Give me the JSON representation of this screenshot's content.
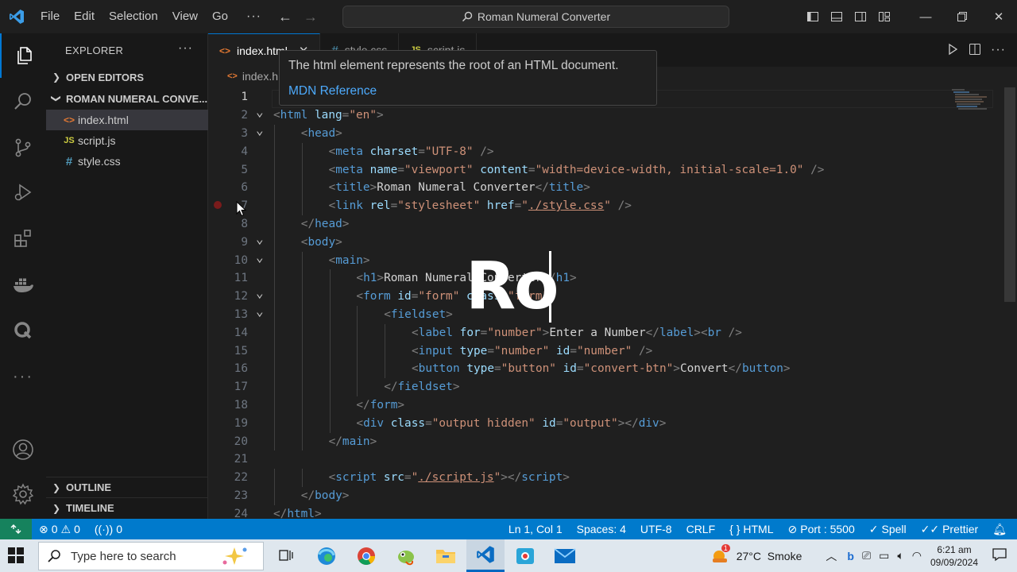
{
  "titlebar": {
    "menu": [
      "File",
      "Edit",
      "Selection",
      "View",
      "Go"
    ],
    "more": "···",
    "command_center": "Roman Numeral Converter"
  },
  "activity_bar": {
    "items": [
      "explorer-icon",
      "search-icon",
      "source-control-icon",
      "run-debug-icon",
      "extensions-icon",
      "docker-icon",
      "quokka-icon",
      "more-icon",
      "account-icon",
      "settings-gear-icon"
    ]
  },
  "sidebar": {
    "title": "EXPLORER",
    "more": "···",
    "open_editors": "OPEN EDITORS",
    "folder": "ROMAN NUMERAL CONVE...",
    "files": [
      {
        "name": "index.html",
        "icon": "<>"
      },
      {
        "name": "script.js",
        "icon": "JS"
      },
      {
        "name": "style.css",
        "icon": "#"
      }
    ],
    "outline": "OUTLINE",
    "timeline": "TIMELINE"
  },
  "tabs": [
    {
      "label": "index.html",
      "icon": "<>",
      "active": true,
      "close": "✕"
    },
    {
      "label": "style.css",
      "icon": "#",
      "active": false
    },
    {
      "label": "script.js",
      "icon": "JS",
      "active": false
    }
  ],
  "breadcrumb": {
    "icon": "<>",
    "file": "index.h"
  },
  "hover": {
    "text": "The html element represents the root of an HTML document.",
    "link": "MDN Reference"
  },
  "editor": {
    "lines": [
      {
        "n": "1",
        "fold": "",
        "indent": 0,
        "tokens": []
      },
      {
        "n": "2",
        "fold": "v",
        "indent": 0,
        "tokens": [
          [
            "br",
            "<"
          ],
          [
            "tag",
            "html"
          ],
          [
            "txt",
            " "
          ],
          [
            "attr",
            "lang"
          ],
          [
            "br",
            "="
          ],
          [
            "str",
            "\"en\""
          ],
          [
            "br",
            ">"
          ]
        ]
      },
      {
        "n": "3",
        "fold": "v",
        "indent": 1,
        "tokens": [
          [
            "br",
            "<"
          ],
          [
            "tag",
            "head"
          ],
          [
            "br",
            ">"
          ]
        ]
      },
      {
        "n": "4",
        "fold": "",
        "indent": 2,
        "tokens": [
          [
            "br",
            "<"
          ],
          [
            "tag",
            "meta"
          ],
          [
            "txt",
            " "
          ],
          [
            "attr",
            "charset"
          ],
          [
            "br",
            "="
          ],
          [
            "str",
            "\"UTF-8\""
          ],
          [
            "txt",
            " "
          ],
          [
            "br",
            "/>"
          ]
        ]
      },
      {
        "n": "5",
        "fold": "",
        "indent": 2,
        "tokens": [
          [
            "br",
            "<"
          ],
          [
            "tag",
            "meta"
          ],
          [
            "txt",
            " "
          ],
          [
            "attr",
            "name"
          ],
          [
            "br",
            "="
          ],
          [
            "str",
            "\"viewport\""
          ],
          [
            "txt",
            " "
          ],
          [
            "attr",
            "content"
          ],
          [
            "br",
            "="
          ],
          [
            "str",
            "\"width=device-width, initial-scale=1.0\""
          ],
          [
            "txt",
            " "
          ],
          [
            "br",
            "/>"
          ]
        ]
      },
      {
        "n": "6",
        "fold": "",
        "indent": 2,
        "tokens": [
          [
            "br",
            "<"
          ],
          [
            "tag",
            "title"
          ],
          [
            "br",
            ">"
          ],
          [
            "txt",
            "Roman Numeral Converter"
          ],
          [
            "br",
            "</"
          ],
          [
            "tag",
            "title"
          ],
          [
            "br",
            ">"
          ]
        ]
      },
      {
        "n": "7",
        "fold": "",
        "indent": 2,
        "tokens": [
          [
            "br",
            "<"
          ],
          [
            "tag",
            "link"
          ],
          [
            "txt",
            " "
          ],
          [
            "attr",
            "rel"
          ],
          [
            "br",
            "="
          ],
          [
            "str",
            "\"stylesheet\""
          ],
          [
            "txt",
            " "
          ],
          [
            "attr",
            "href"
          ],
          [
            "br",
            "="
          ],
          [
            "str",
            "\""
          ],
          [
            "link",
            "./style.css"
          ],
          [
            "str",
            "\""
          ],
          [
            "txt",
            " "
          ],
          [
            "br",
            "/>"
          ]
        ]
      },
      {
        "n": "8",
        "fold": "",
        "indent": 1,
        "tokens": [
          [
            "br",
            "</"
          ],
          [
            "tag",
            "head"
          ],
          [
            "br",
            ">"
          ]
        ]
      },
      {
        "n": "9",
        "fold": "v",
        "indent": 1,
        "tokens": [
          [
            "br",
            "<"
          ],
          [
            "tag",
            "body"
          ],
          [
            "br",
            ">"
          ]
        ]
      },
      {
        "n": "10",
        "fold": "v",
        "indent": 2,
        "tokens": [
          [
            "br",
            "<"
          ],
          [
            "tag",
            "main"
          ],
          [
            "br",
            ">"
          ]
        ]
      },
      {
        "n": "11",
        "fold": "",
        "indent": 3,
        "tokens": [
          [
            "br",
            "<"
          ],
          [
            "tag",
            "h1"
          ],
          [
            "br",
            ">"
          ],
          [
            "txt",
            "Roman Numeral Converter"
          ],
          [
            "br",
            "</"
          ],
          [
            "tag",
            "h1"
          ],
          [
            "br",
            ">"
          ]
        ]
      },
      {
        "n": "12",
        "fold": "v",
        "indent": 3,
        "tokens": [
          [
            "br",
            "<"
          ],
          [
            "tag",
            "form"
          ],
          [
            "txt",
            " "
          ],
          [
            "attr",
            "id"
          ],
          [
            "br",
            "="
          ],
          [
            "str",
            "\"form\""
          ],
          [
            "txt",
            " "
          ],
          [
            "attr",
            "class"
          ],
          [
            "br",
            "="
          ],
          [
            "str",
            "\"form\""
          ],
          [
            "br",
            ">"
          ]
        ]
      },
      {
        "n": "13",
        "fold": "v",
        "indent": 4,
        "tokens": [
          [
            "br",
            "<"
          ],
          [
            "tag",
            "fieldset"
          ],
          [
            "br",
            ">"
          ]
        ]
      },
      {
        "n": "14",
        "fold": "",
        "indent": 5,
        "tokens": [
          [
            "br",
            "<"
          ],
          [
            "tag",
            "label"
          ],
          [
            "txt",
            " "
          ],
          [
            "attr",
            "for"
          ],
          [
            "br",
            "="
          ],
          [
            "str",
            "\"number\""
          ],
          [
            "br",
            ">"
          ],
          [
            "txt",
            "Enter a Number"
          ],
          [
            "br",
            "</"
          ],
          [
            "tag",
            "label"
          ],
          [
            "br",
            "><"
          ],
          [
            "tag",
            "br"
          ],
          [
            "txt",
            " "
          ],
          [
            "br",
            "/>"
          ]
        ]
      },
      {
        "n": "15",
        "fold": "",
        "indent": 5,
        "tokens": [
          [
            "br",
            "<"
          ],
          [
            "tag",
            "input"
          ],
          [
            "txt",
            " "
          ],
          [
            "attr",
            "type"
          ],
          [
            "br",
            "="
          ],
          [
            "str",
            "\"number\""
          ],
          [
            "txt",
            " "
          ],
          [
            "attr",
            "id"
          ],
          [
            "br",
            "="
          ],
          [
            "str",
            "\"number\""
          ],
          [
            "txt",
            " "
          ],
          [
            "br",
            "/>"
          ]
        ]
      },
      {
        "n": "16",
        "fold": "",
        "indent": 5,
        "tokens": [
          [
            "br",
            "<"
          ],
          [
            "tag",
            "button"
          ],
          [
            "txt",
            " "
          ],
          [
            "attr",
            "type"
          ],
          [
            "br",
            "="
          ],
          [
            "str",
            "\"button\""
          ],
          [
            "txt",
            " "
          ],
          [
            "attr",
            "id"
          ],
          [
            "br",
            "="
          ],
          [
            "str",
            "\"convert-btn\""
          ],
          [
            "br",
            ">"
          ],
          [
            "txt",
            "Convert"
          ],
          [
            "br",
            "</"
          ],
          [
            "tag",
            "button"
          ],
          [
            "br",
            ">"
          ]
        ]
      },
      {
        "n": "17",
        "fold": "",
        "indent": 4,
        "tokens": [
          [
            "br",
            "</"
          ],
          [
            "tag",
            "fieldset"
          ],
          [
            "br",
            ">"
          ]
        ]
      },
      {
        "n": "18",
        "fold": "",
        "indent": 3,
        "tokens": [
          [
            "br",
            "</"
          ],
          [
            "tag",
            "form"
          ],
          [
            "br",
            ">"
          ]
        ]
      },
      {
        "n": "19",
        "fold": "",
        "indent": 3,
        "tokens": [
          [
            "br",
            "<"
          ],
          [
            "tag",
            "div"
          ],
          [
            "txt",
            " "
          ],
          [
            "attr",
            "class"
          ],
          [
            "br",
            "="
          ],
          [
            "str",
            "\"output hidden\""
          ],
          [
            "txt",
            " "
          ],
          [
            "attr",
            "id"
          ],
          [
            "br",
            "="
          ],
          [
            "str",
            "\"output\""
          ],
          [
            "br",
            "></"
          ],
          [
            "tag",
            "div"
          ],
          [
            "br",
            ">"
          ]
        ]
      },
      {
        "n": "20",
        "fold": "",
        "indent": 2,
        "tokens": [
          [
            "br",
            "</"
          ],
          [
            "tag",
            "main"
          ],
          [
            "br",
            ">"
          ]
        ]
      },
      {
        "n": "21",
        "fold": "",
        "indent": 0,
        "tokens": []
      },
      {
        "n": "22",
        "fold": "",
        "indent": 2,
        "tokens": [
          [
            "br",
            "<"
          ],
          [
            "tag",
            "script"
          ],
          [
            "txt",
            " "
          ],
          [
            "attr",
            "src"
          ],
          [
            "br",
            "="
          ],
          [
            "str",
            "\""
          ],
          [
            "link",
            "./script.js"
          ],
          [
            "str",
            "\""
          ],
          [
            "br",
            "></"
          ],
          [
            "tag",
            "script"
          ],
          [
            "br",
            ">"
          ]
        ]
      },
      {
        "n": "23",
        "fold": "",
        "indent": 1,
        "tokens": [
          [
            "br",
            "</"
          ],
          [
            "tag",
            "body"
          ],
          [
            "br",
            ">"
          ]
        ]
      },
      {
        "n": "24",
        "fold": "",
        "indent": 0,
        "tokens": [
          [
            "br",
            "</"
          ],
          [
            "tag",
            "html"
          ],
          [
            "br",
            ">"
          ]
        ]
      }
    ]
  },
  "overlay_text": "Ro",
  "statusbar": {
    "errors": "0",
    "warnings": "0",
    "ports": "0",
    "position": "Ln 1, Col 1",
    "spaces": "Spaces: 4",
    "encoding": "UTF-8",
    "eol": "CRLF",
    "language": "HTML",
    "port": "Port : 5500",
    "spell": "Spell",
    "prettier": "Prettier"
  },
  "taskbar": {
    "search_placeholder": "Type here to search",
    "weather": "27°C  Smoke",
    "weather_badge": "1",
    "time": "6:21 am",
    "date": "09/09/2024"
  }
}
